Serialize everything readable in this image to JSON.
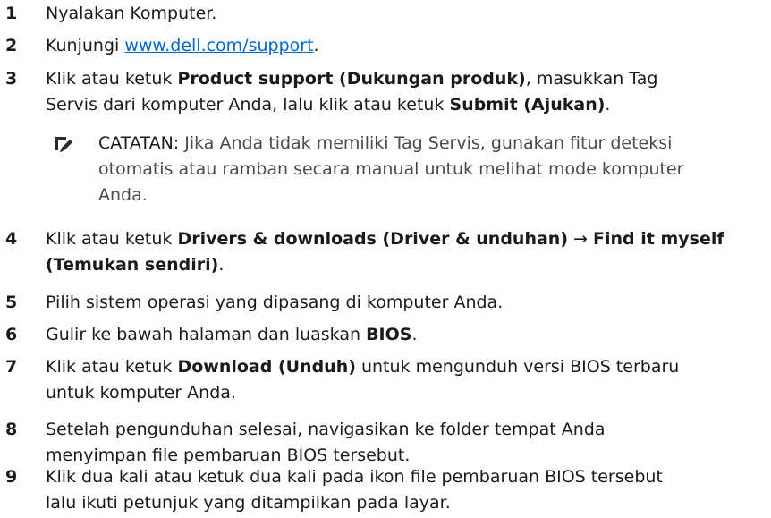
{
  "steps": [
    {
      "num": "1",
      "parts": [
        {
          "t": "Nyalakan Komputer."
        }
      ]
    },
    {
      "num": "2",
      "parts": [
        {
          "t": "Kunjungi "
        },
        {
          "t": "www.dell.com/support",
          "link": true
        },
        {
          "t": "."
        }
      ]
    },
    {
      "num": "3",
      "parts": [
        {
          "t": "Klik atau ketuk "
        },
        {
          "t": "Product support (Dukungan produk)",
          "bold": true
        },
        {
          "t": ", masukkan Tag"
        }
      ],
      "line2": [
        {
          "t": "Servis dari komputer Anda, lalu klik atau ketuk "
        },
        {
          "t": "Submit (Ajukan)",
          "bold": true
        },
        {
          "t": "."
        }
      ]
    },
    {
      "num": "4",
      "parts": [
        {
          "t": "Klik atau ketuk "
        },
        {
          "t": "Drivers & downloads (Driver & unduhan)",
          "bold": true
        },
        {
          "t": " → "
        },
        {
          "t": "Find it myself",
          "bold": true
        }
      ],
      "line2": [
        {
          "t": "(Temukan sendiri)",
          "bold": true
        },
        {
          "t": "."
        }
      ]
    },
    {
      "num": "5",
      "parts": [
        {
          "t": "Pilih sistem operasi yang dipasang di komputer Anda."
        }
      ]
    },
    {
      "num": "6",
      "parts": [
        {
          "t": "Gulir ke bawah halaman dan luaskan "
        },
        {
          "t": "BIOS",
          "bold": true
        },
        {
          "t": "."
        }
      ]
    },
    {
      "num": "7",
      "parts": [
        {
          "t": "Klik atau ketuk "
        },
        {
          "t": "Download (Unduh)",
          "bold": true
        },
        {
          "t": " untuk mengunduh versi BIOS terbaru"
        }
      ],
      "line2": [
        {
          "t": "untuk komputer Anda."
        }
      ]
    },
    {
      "num": "8",
      "parts": [
        {
          "t": "Setelah pengunduhan selesai, navigasikan ke folder tempat Anda"
        }
      ],
      "line2": [
        {
          "t": "menyimpan file pembaruan BIOS tersebut."
        }
      ]
    },
    {
      "num": "9",
      "parts": [
        {
          "t": "Klik dua kali atau ketuk dua kali pada ikon file pembaruan BIOS tersebut"
        }
      ],
      "line2": [
        {
          "t": "lalu ikuti petunjuk yang ditampilkan pada layar."
        }
      ]
    }
  ],
  "note": {
    "label": "CATATAN:",
    "line1": " Jika Anda tidak memiliki Tag Servis, gunakan fitur deteksi",
    "line2": "otomatis atau ramban secara manual untuk melihat mode komputer",
    "line3": "Anda.",
    "icon": "pencil-note-icon"
  },
  "colors": {
    "link": "#0066cc",
    "text": "#1a1a1a",
    "note_text": "#4a4a4a"
  }
}
